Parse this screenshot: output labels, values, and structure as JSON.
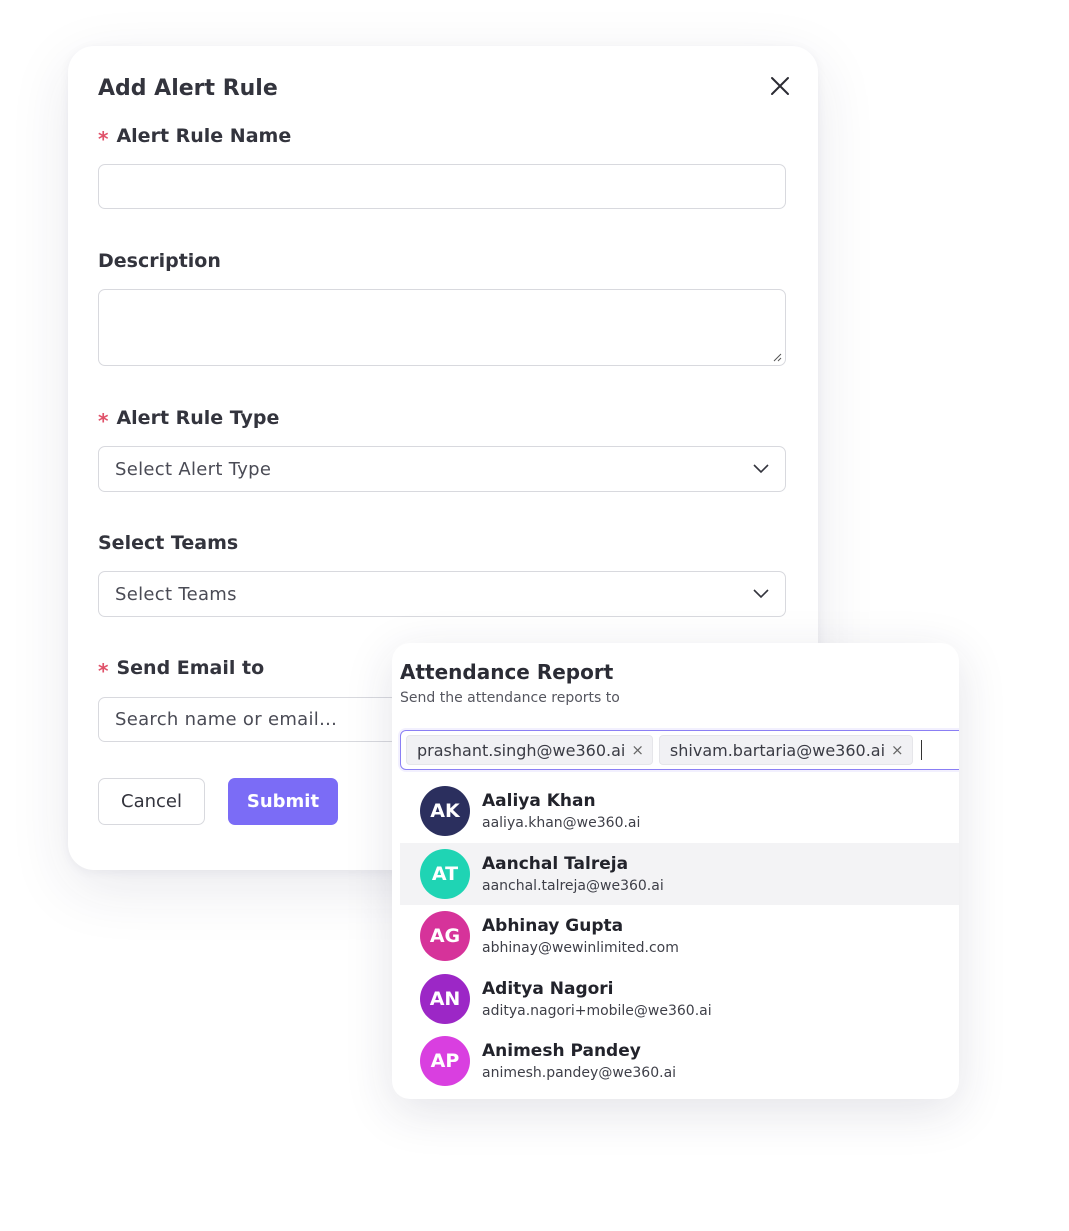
{
  "modal": {
    "title": "Add Alert Rule",
    "fields": {
      "rule_name": {
        "label": "Alert Rule Name",
        "required": true,
        "value": ""
      },
      "description": {
        "label": "Description",
        "required": false,
        "value": ""
      },
      "rule_type": {
        "label": "Alert Rule Type",
        "required": true,
        "placeholder": "Select Alert Type"
      },
      "teams": {
        "label": "Select Teams",
        "required": false,
        "placeholder": "Select Teams"
      },
      "send_email": {
        "label": "Send Email to",
        "required": true,
        "placeholder": "Search name or email..."
      }
    },
    "buttons": {
      "cancel": "Cancel",
      "submit": "Submit"
    }
  },
  "attendance": {
    "title": "Attendance Report",
    "subtitle": "Send the attendance reports to",
    "selected": [
      {
        "email": "prashant.singh@we360.ai",
        "remove": "×"
      },
      {
        "email": "shivam.bartaria@we360.ai",
        "remove": "×"
      }
    ],
    "users": [
      {
        "initials": "AK",
        "name": "Aaliya Khan",
        "email": "aaliya.khan@we360.ai",
        "color": "#2b2f5e"
      },
      {
        "initials": "AT",
        "name": "Aanchal Talreja",
        "email": "aanchal.talreja@we360.ai",
        "color": "#1fd4b4",
        "highlighted": true
      },
      {
        "initials": "AG",
        "name": "Abhinay Gupta",
        "email": "abhinay@wewinlimited.com",
        "color": "#d6339a"
      },
      {
        "initials": "AN",
        "name": "Aditya Nagori",
        "email": "aditya.nagori+mobile@we360.ai",
        "color": "#9c27c6"
      },
      {
        "initials": "AP",
        "name": "Animesh Pandey",
        "email": "animesh.pandey@we360.ai",
        "color": "#d93fe0"
      }
    ]
  },
  "colors": {
    "accent": "#7b6cf6",
    "required": "#e0526a",
    "border": "#d8d9de"
  }
}
